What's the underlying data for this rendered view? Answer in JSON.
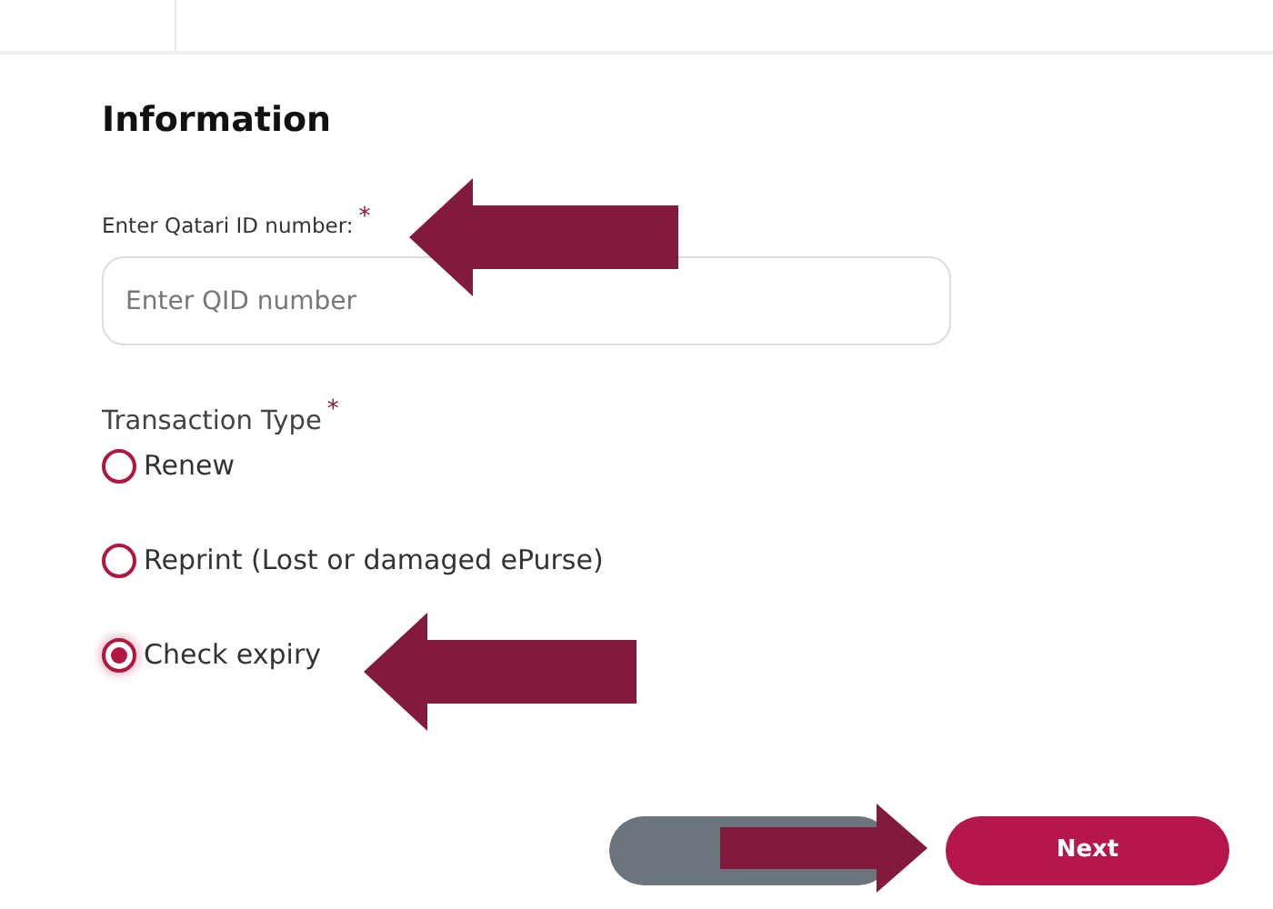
{
  "form": {
    "title": "Information",
    "qid": {
      "label": "Enter Qatari ID number:",
      "required": "*",
      "placeholder": "Enter QID number"
    },
    "transaction_type": {
      "label": "Transaction Type",
      "required": "*",
      "options": [
        {
          "label": "Renew",
          "selected": false
        },
        {
          "label": "Reprint (Lost or damaged ePurse)",
          "selected": false
        },
        {
          "label": "Check expiry",
          "selected": true
        }
      ]
    },
    "buttons": [
      {
        "kind": "secondary"
      },
      {
        "kind": "primary",
        "label": "Next"
      }
    ]
  },
  "annotations": [
    {
      "kind": "arrow-left"
    },
    {
      "kind": "arrow-left"
    },
    {
      "kind": "arrow-right"
    }
  ]
}
